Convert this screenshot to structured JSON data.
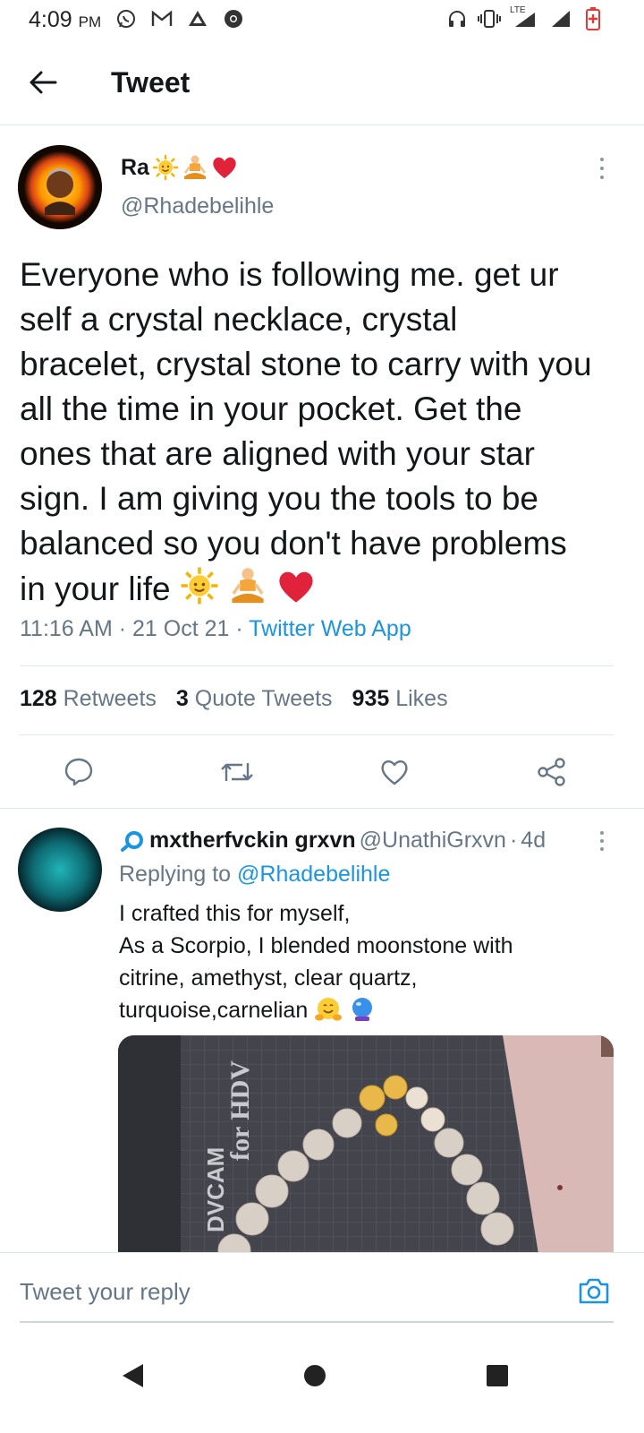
{
  "status_bar": {
    "time": "4:09",
    "ampm": "PM",
    "network_label": "LTE"
  },
  "header": {
    "title": "Tweet"
  },
  "tweet": {
    "author_name": "Ra",
    "author_handle": "@Rhadebelihle",
    "text": "Everyone who is following me. get ur self a crystal necklace, crystal bracelet, crystal stone to carry with you all the time in your pocket. Get the ones that are aligned with your star sign. I am giving you the tools to be balanced so you don't have problems in your life",
    "timestamp": "11:16 AM · 21 Oct 21 · ",
    "source": "Twitter Web App",
    "retweets_count": "128",
    "retweets_label": "Retweets",
    "quotes_count": "3",
    "quotes_label": "Quote Tweets",
    "likes_count": "935",
    "likes_label": "Likes"
  },
  "reply": {
    "name": "mxtherfvckin grxvn",
    "handle": "@UnathiGrxvn",
    "separator": "·",
    "age": "4d",
    "replying_prefix": "Replying to",
    "replying_to": "@Rhadebelihle",
    "lines": [
      "I crafted this for myself,",
      "As a Scorpio, I blended moonstone with",
      "citrine, amethyst, clear quartz,",
      "turquoise,carnelian"
    ],
    "media_text_1": "DVCAM",
    "media_text_2": "for HDV"
  },
  "reply_bar": {
    "placeholder": "Tweet your reply"
  },
  "colors": {
    "accent": "#1b95e0",
    "secondary_text": "#657786",
    "divider": "#e1e8ed"
  }
}
